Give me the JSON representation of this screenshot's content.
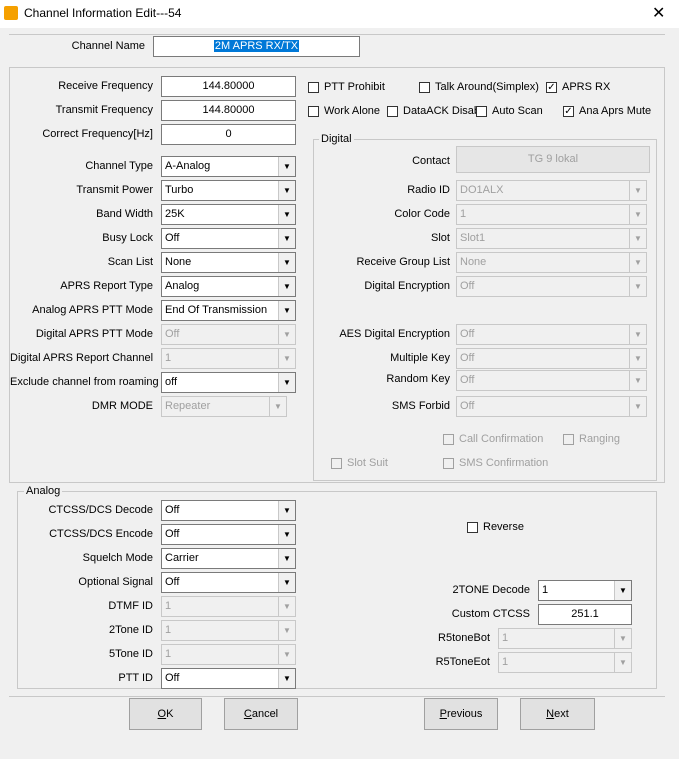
{
  "window": {
    "title": "Channel Information Edit---54",
    "close": "✕"
  },
  "channel_name": {
    "label": "Channel Name",
    "value": "2M APRS RX/TX"
  },
  "left": {
    "receive_frequency": {
      "label": "Receive Frequency",
      "value": "144.80000"
    },
    "transmit_frequency": {
      "label": "Transmit Frequency",
      "value": "144.80000"
    },
    "correct_frequency": {
      "label": "Correct Frequency[Hz]",
      "value": "0"
    },
    "channel_type": {
      "label": "Channel Type",
      "value": "A-Analog"
    },
    "transmit_power": {
      "label": "Transmit Power",
      "value": "Turbo"
    },
    "band_width": {
      "label": "Band Width",
      "value": "25K"
    },
    "busy_lock": {
      "label": "Busy Lock",
      "value": "Off"
    },
    "scan_list": {
      "label": "Scan List",
      "value": "None"
    },
    "aprs_report_type": {
      "label": "APRS Report Type",
      "value": "Analog"
    },
    "analog_aprs_ptt_mode": {
      "label": "Analog APRS PTT Mode",
      "value": "End Of Transmission"
    },
    "digital_aprs_ptt_mode": {
      "label": "Digital APRS PTT Mode",
      "value": "Off"
    },
    "digital_aprs_report_channel": {
      "label": "Digital APRS Report Channel",
      "value": "1"
    },
    "exclude_roaming": {
      "label": "Exclude channel from roaming",
      "value": "off"
    },
    "dmr_mode": {
      "label": "DMR MODE",
      "value": "Repeater"
    }
  },
  "checks": {
    "ptt_prohibit": {
      "label": "PTT Prohibit",
      "checked": false
    },
    "talk_around": {
      "label": "Talk Around(Simplex)",
      "checked": false
    },
    "aprs_rx": {
      "label": "APRS RX",
      "checked": true
    },
    "work_alone": {
      "label": "Work Alone",
      "checked": false
    },
    "data_ack": {
      "label": "DataACK Disabl",
      "checked": false
    },
    "auto_scan": {
      "label": "Auto Scan",
      "checked": false
    },
    "ana_aprs_mute": {
      "label": "Ana Aprs Mute",
      "checked": true
    }
  },
  "digital": {
    "title": "Digital",
    "contact": {
      "label": "Contact",
      "value": "TG 9 lokal"
    },
    "radio_id": {
      "label": "Radio ID",
      "value": "DO1ALX"
    },
    "color_code": {
      "label": "Color Code",
      "value": "1"
    },
    "slot": {
      "label": "Slot",
      "value": "Slot1"
    },
    "receive_group_list": {
      "label": "Receive Group List",
      "value": "None"
    },
    "digital_encryption": {
      "label": "Digital Encryption",
      "value": "Off"
    },
    "aes_digital_encryption": {
      "label": "AES Digital Encryption",
      "value": "Off"
    },
    "multiple_key": {
      "label": "Multiple Key",
      "value": "Off"
    },
    "random_key": {
      "label": "Random Key",
      "value": "Off"
    },
    "sms_forbid": {
      "label": "SMS Forbid",
      "value": "Off"
    },
    "call_confirmation": "Call Confirmation",
    "ranging": "Ranging",
    "slot_suit": "Slot Suit",
    "sms_confirmation": "SMS Confirmation"
  },
  "analog": {
    "title": "Analog",
    "ctcss_decode": {
      "label": "CTCSS/DCS Decode",
      "value": "Off"
    },
    "ctcss_encode": {
      "label": "CTCSS/DCS Encode",
      "value": "Off"
    },
    "squelch_mode": {
      "label": "Squelch Mode",
      "value": "Carrier"
    },
    "optional_signal": {
      "label": "Optional Signal",
      "value": "Off"
    },
    "dtmf_id": {
      "label": "DTMF ID",
      "value": "1"
    },
    "two_tone_id": {
      "label": "2Tone ID",
      "value": "1"
    },
    "five_tone_id": {
      "label": "5Tone ID",
      "value": "1"
    },
    "ptt_id": {
      "label": "PTT ID",
      "value": "Off"
    },
    "reverse": {
      "label": "Reverse",
      "checked": false
    },
    "two_tone_decode": {
      "label": "2TONE Decode",
      "value": "1"
    },
    "custom_ctcss": {
      "label": "Custom CTCSS",
      "value": "251.1"
    },
    "r5tone_bot": {
      "label": "R5toneBot",
      "value": "1"
    },
    "r5tone_eot": {
      "label": "R5ToneEot",
      "value": "1"
    }
  },
  "buttons": {
    "ok": {
      "mnemonic": "O",
      "rest": "K"
    },
    "cancel": {
      "mnemonic": "C",
      "rest": "ancel"
    },
    "previous": {
      "mnemonic": "P",
      "rest": "revious"
    },
    "next": {
      "mnemonic": "N",
      "rest": "ext"
    }
  },
  "icons": {
    "dropdown": "▼",
    "check": "✓"
  }
}
